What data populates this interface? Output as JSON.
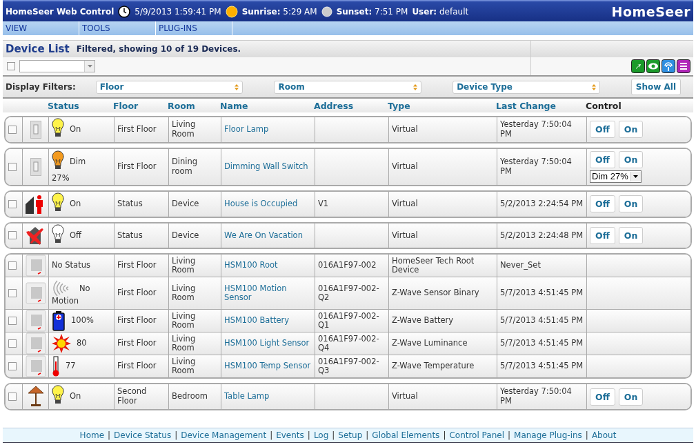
{
  "top_bar": {
    "title": "HomeSeer Web Control",
    "date_time": "5/9/2013 1:59:41 PM",
    "sunrise_label": "Sunrise:",
    "sunrise": "5:29 AM",
    "sunset_label": "Sunset:",
    "sunset": "7:51 PM",
    "user_label": "User:",
    "user": "default",
    "logo": "HomeSeer"
  },
  "menu": [
    "VIEW",
    "TOOLS",
    "PLUG-INS"
  ],
  "page": {
    "title": "Device List",
    "subtitle": "Filtered, showing 10 of 19 Devices."
  },
  "select_all": {
    "checked": false
  },
  "filters": {
    "label": "Display Filters:",
    "selects": [
      "Floor",
      "Room",
      "Device Type"
    ],
    "button": "Show All"
  },
  "columns": [
    "Status",
    "Floor",
    "Room",
    "Name",
    "Address",
    "Type",
    "Last Change",
    "Control"
  ],
  "groups": [
    {
      "devices": [
        {
          "checked": false,
          "device_icon": {
            "kind": "switch"
          },
          "status_icon": {
            "kind": "bulb-on"
          },
          "status": "On",
          "floor": "First Floor",
          "room": "Living Room",
          "name": "Floor Lamp",
          "type": "Virtual",
          "last_change": "Yesterday 7:50:04 PM",
          "buttons": [
            "Off",
            "On"
          ]
        }
      ]
    },
    {
      "devices": [
        {
          "checked": false,
          "device_icon": {
            "kind": "switch"
          },
          "status_icon": {
            "kind": "bulb-dim"
          },
          "status": "Dim",
          "status_detail": "27%",
          "floor": "First Floor",
          "room": "Dining room",
          "name": "Dimming Wall Switch",
          "type": "Virtual",
          "last_change": "Yesterday 7:50:04 PM",
          "buttons": [
            "Off",
            "On"
          ],
          "dropdown": "Dim 27%"
        }
      ]
    },
    {
      "devices": [
        {
          "checked": false,
          "device_icon": {
            "kind": "occupied"
          },
          "status_icon": {
            "kind": "bulb-on"
          },
          "status": "On",
          "floor": "Status",
          "room": "Device",
          "name": "House is Occupied",
          "address": "V1",
          "type": "Virtual",
          "last_change": "5/2/2013 2:24:54 PM",
          "buttons": [
            "Off",
            "On"
          ]
        }
      ]
    },
    {
      "devices": [
        {
          "checked": false,
          "device_icon": {
            "kind": "vacation"
          },
          "status_icon": {
            "kind": "bulb-off"
          },
          "status": "Off",
          "floor": "Status",
          "room": "Device",
          "name": "We Are On Vacation",
          "type": "Virtual",
          "last_change": "5/2/2013 2:24:48 PM",
          "buttons": [
            "Off",
            "On"
          ]
        }
      ]
    },
    {
      "devices": [
        {
          "checked": false,
          "device_icon": {
            "kind": "sensor"
          },
          "status": "No Status",
          "floor": "First Floor",
          "room": "Living Room",
          "name": "HSM100 Root",
          "address": "016A1F97-002",
          "type": "HomeSeer Tech Root Device",
          "last_change": "Never_Set"
        },
        {
          "checked": false,
          "device_icon": {
            "kind": "sensor"
          },
          "status_icon": {
            "kind": "motion"
          },
          "status": "No",
          "status_detail": "Motion",
          "floor": "First Floor",
          "room": "Living Room",
          "name": "HSM100 Motion Sensor",
          "address": "016A1F97-002-Q2",
          "type": "Z-Wave Sensor Binary",
          "last_change": "5/7/2013 4:51:45 PM"
        },
        {
          "checked": false,
          "device_icon": {
            "kind": "sensor"
          },
          "status_icon": {
            "kind": "battery"
          },
          "status": "100%",
          "floor": "First Floor",
          "room": "Living Room",
          "name": "HSM100 Battery",
          "address": "016A1F97-002-Q1",
          "type": "Z-Wave Battery",
          "last_change": "5/7/2013 4:51:45 PM"
        },
        {
          "checked": false,
          "device_icon": {
            "kind": "sensor"
          },
          "status_icon": {
            "kind": "light"
          },
          "status": "80",
          "floor": "First Floor",
          "room": "Living Room",
          "name": "HSM100 Light Sensor",
          "address": "016A1F97-002-Q4",
          "type": "Z-Wave Luminance",
          "last_change": "5/7/2013 4:51:45 PM"
        },
        {
          "checked": false,
          "device_icon": {
            "kind": "sensor"
          },
          "status_icon": {
            "kind": "thermometer"
          },
          "status": "77",
          "floor": "First Floor",
          "room": "Living Room",
          "name": "HSM100 Temp Sensor",
          "address": "016A1F97-002-Q3",
          "type": "Z-Wave Temperature",
          "last_change": "5/7/2013 4:51:45 PM"
        }
      ]
    },
    {
      "devices": [
        {
          "checked": false,
          "device_icon": {
            "kind": "lamp"
          },
          "status_icon": {
            "kind": "bulb-on"
          },
          "status": "On",
          "floor": "Second Floor",
          "room": "Bedroom",
          "name": "Table Lamp",
          "type": "Virtual",
          "last_change": "Yesterday 7:50:04 PM",
          "buttons": [
            "Off",
            "On"
          ]
        }
      ]
    }
  ],
  "footer": {
    "separator": "|",
    "links": [
      "Home",
      "Device Status",
      "Device Management",
      "Events",
      "Log",
      "Setup",
      "Global Elements",
      "Control Panel",
      "Manage Plug-ins",
      "About"
    ]
  }
}
